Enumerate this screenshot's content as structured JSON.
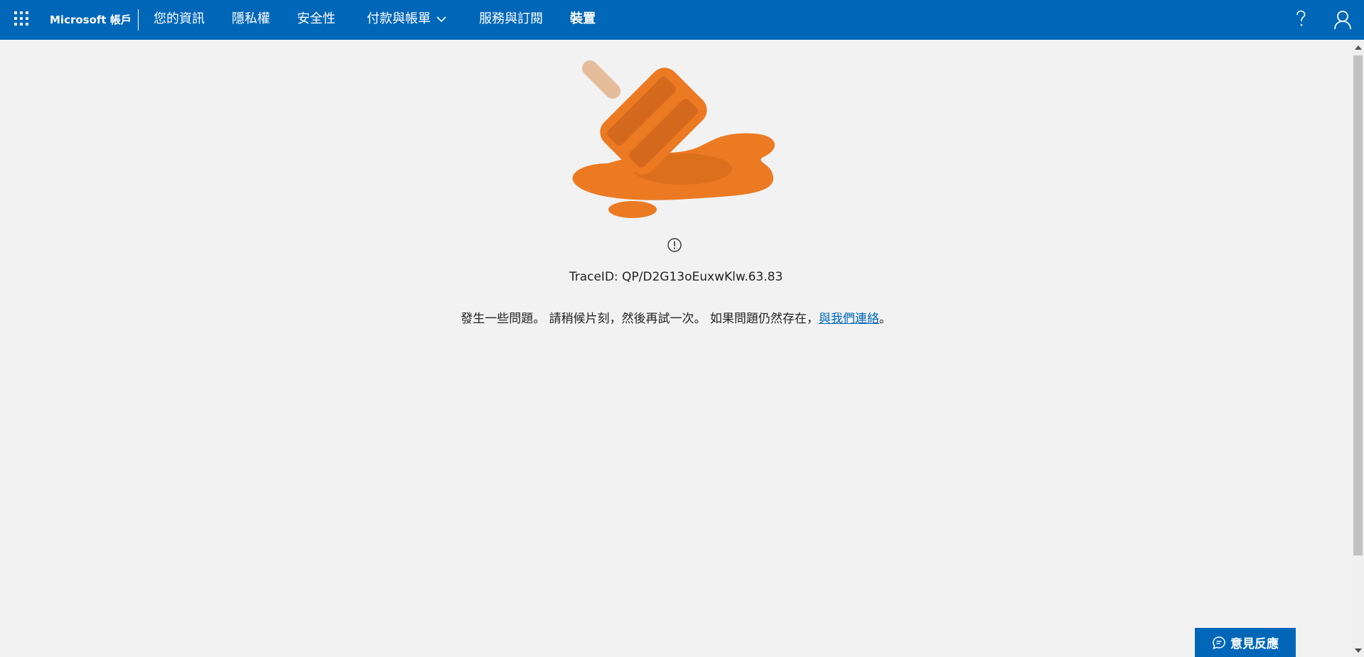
{
  "header": {
    "brand": "Microsoft 帳戶",
    "nav": [
      {
        "label": "您的資訊"
      },
      {
        "label": "隱私權"
      },
      {
        "label": "安全性"
      },
      {
        "label": "付款與帳單"
      },
      {
        "label": "服務與訂閱"
      },
      {
        "label": "裝置"
      }
    ],
    "help_icon": "question-mark-icon",
    "user_icon": "person-icon",
    "apps_icon": "waffle-grid-icon"
  },
  "error": {
    "illustration": "melted-popsicle-illustration",
    "icon": "exclamation-circle-icon",
    "trace": "TraceID: QP/D2G13oEuxwKlw.63.83",
    "message_prefix": "發生一些問題。 請稍候片刻，然後再試一次。 如果問題仍然存在，",
    "contact_link": "與我們連絡",
    "message_suffix": "。"
  },
  "feedback": {
    "label": "意見反應",
    "icon": "chat-bubble-icon"
  },
  "colors": {
    "header_bg": "#0067b8",
    "page_bg": "#f2f2f2",
    "accent_orange": "#e97623"
  }
}
